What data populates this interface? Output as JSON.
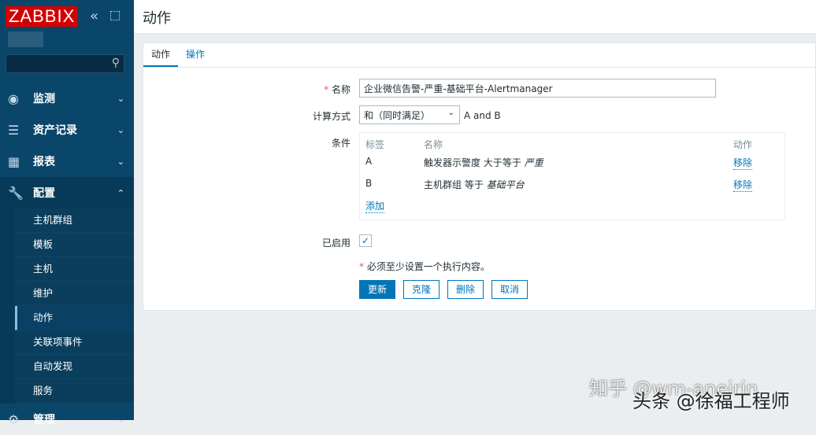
{
  "sidebar": {
    "logo": "ZABBIX",
    "collapse": "«",
    "search_icon": "⚲",
    "menu": [
      {
        "label": "监测",
        "icon": "◉"
      },
      {
        "label": "资产记录",
        "icon": "☰"
      },
      {
        "label": "报表",
        "icon": "▦"
      },
      {
        "label": "配置",
        "icon": "🔧"
      },
      {
        "label": "管理",
        "icon": "⚙"
      }
    ],
    "submenu": [
      "主机群组",
      "模板",
      "主机",
      "维护",
      "动作",
      "关联项事件",
      "自动发现",
      "服务"
    ]
  },
  "header": {
    "title": "动作"
  },
  "tabs": [
    "动作",
    "操作"
  ],
  "form": {
    "name_label": "名称",
    "required_mark": "*",
    "name_value": "企业微信告警-严重-基础平台-Alertmanager",
    "calc_label": "计算方式",
    "calc_value": "和（同时满足）",
    "calc_expr": "A and B",
    "cond_label": "条件",
    "cond_headers": [
      "标签",
      "名称",
      "动作"
    ],
    "conditions": [
      {
        "tag": "A",
        "name": "触发器示警度 大于等于 ",
        "value": "严重",
        "action": "移除"
      },
      {
        "tag": "B",
        "name": "主机群组 等于 ",
        "value": "基础平台",
        "action": "移除"
      }
    ],
    "add": "添加",
    "enabled_label": "已启用",
    "enabled": true,
    "note": "必须至少设置一个执行内容。",
    "buttons": [
      "更新",
      "克隆",
      "删除",
      "取消"
    ]
  },
  "watermark": {
    "zhihu": "知乎 @wm-aneirin",
    "toutiao": "头条 @徐福工程师"
  }
}
